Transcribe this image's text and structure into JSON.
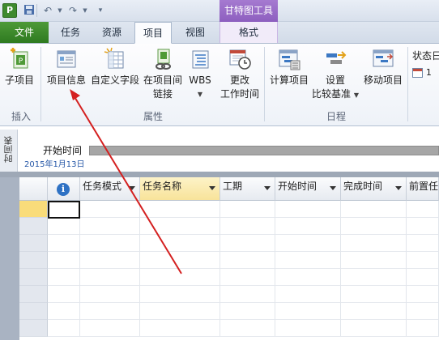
{
  "titlebar": {
    "app_icon": "P",
    "context_tab_title": "甘特图工具"
  },
  "tabs": [
    "文件",
    "任务",
    "资源",
    "项目",
    "视图",
    "格式"
  ],
  "ribbon": {
    "buttons": {
      "subproject": "子项目",
      "project_info": "项目信息",
      "custom_fields": "自定义字段",
      "links_line1": "在项目间",
      "links_line2": "链接",
      "wbs": "WBS",
      "change_time_line1": "更改",
      "change_time_line2": "工作时间",
      "calc_project": "计算项目",
      "set_baseline_line1": "设置",
      "set_baseline_line2": "比较基准",
      "move_project": "移动项目",
      "status_date_partial": "状态日",
      "status_date_value_partial": "1"
    },
    "groups": {
      "insert": "插入",
      "properties": "属性",
      "schedule": "日程"
    }
  },
  "timeline": {
    "side_label": "时间表",
    "start_label": "开始时间",
    "start_date": "2015年1月13日"
  },
  "grid": {
    "columns": [
      "任务模式",
      "任务名称",
      "工期",
      "开始时间",
      "完成时间",
      "前置任"
    ]
  },
  "colors": {
    "file_tab": "#3a8a2a",
    "context_tab": "#9a6cc8",
    "arrow": "#d42020"
  }
}
